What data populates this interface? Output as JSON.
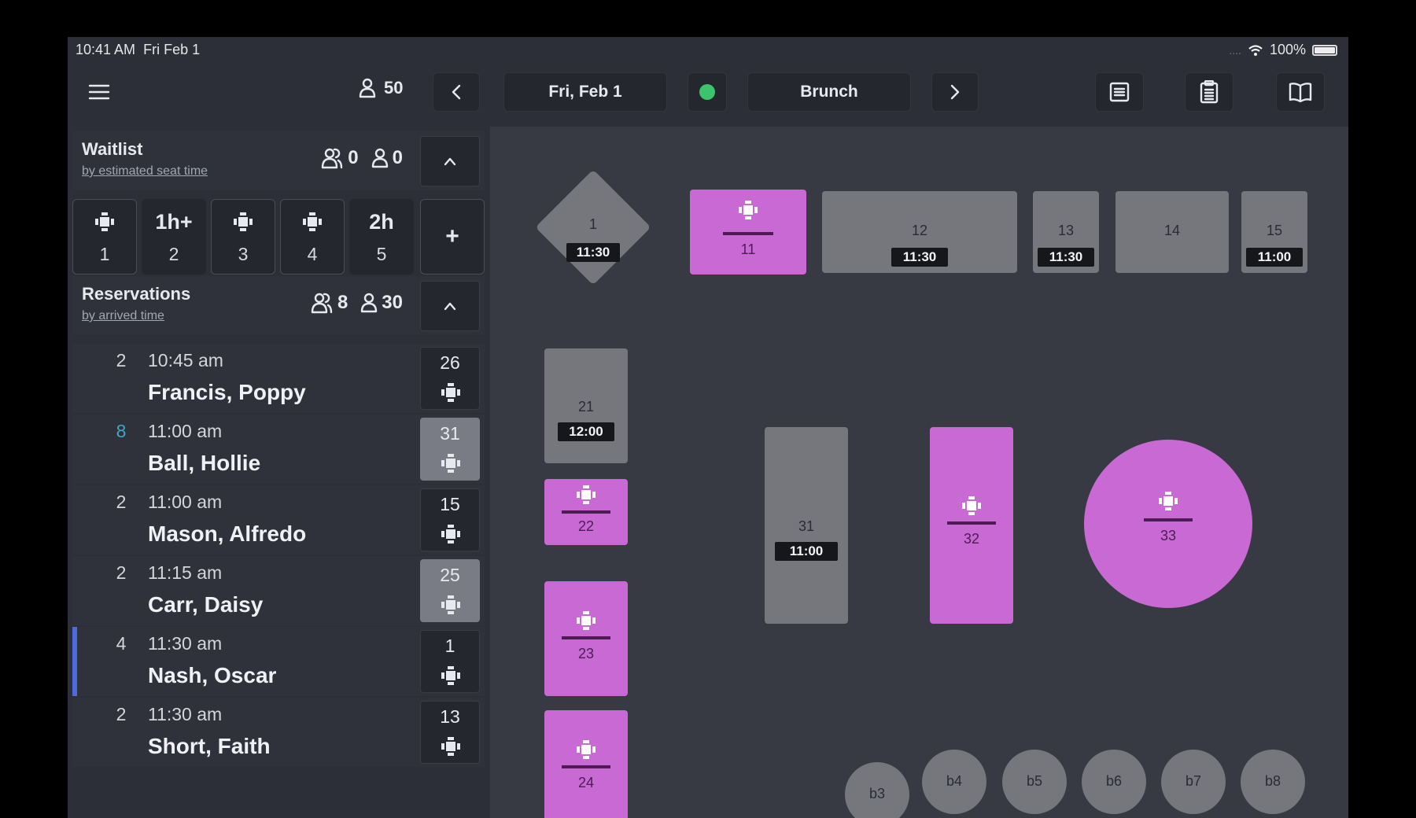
{
  "status_bar": {
    "time": "10:41 AM",
    "date": "Fri Feb 1",
    "battery": "100%",
    "cellular_dots": "...."
  },
  "top_bar": {
    "covers": "50",
    "date": "Fri, Feb 1",
    "shift_status_color": "#3cc46a",
    "shift": "Brunch",
    "icons": [
      "menu-icon",
      "person-icon",
      "chevron-left-icon",
      "chevron-right-icon",
      "list-icon",
      "clipboard-icon",
      "book-icon"
    ]
  },
  "waitlist": {
    "title": "Waitlist",
    "sort": "by estimated seat time",
    "parties": "0",
    "guests": "0",
    "tiles": [
      {
        "top": "",
        "icon": "table-icon",
        "bottom": "1"
      },
      {
        "top": "1h+",
        "icon": "",
        "bottom": "2"
      },
      {
        "top": "",
        "icon": "table-icon",
        "bottom": "3"
      },
      {
        "top": "",
        "icon": "table-icon",
        "bottom": "4"
      },
      {
        "top": "2h",
        "icon": "",
        "bottom": "5"
      }
    ],
    "add_label": "+"
  },
  "reservations": {
    "title": "Reservations",
    "sort": "by arrived time",
    "parties": "8",
    "guests": "30",
    "rows": [
      {
        "party": "2",
        "time": "10:45 am",
        "name": "Francis, Poppy",
        "table": "26"
      },
      {
        "party": "8",
        "time": "11:00 am",
        "name": "Ball, Hollie",
        "table": "31"
      },
      {
        "party": "2",
        "time": "11:00 am",
        "name": "Mason, Alfredo",
        "table": "15"
      },
      {
        "party": "2",
        "time": "11:15 am",
        "name": "Carr, Daisy",
        "table": "25"
      },
      {
        "party": "4",
        "time": "11:30 am",
        "name": "Nash, Oscar",
        "table": "1"
      },
      {
        "party": "2",
        "time": "11:30 am",
        "name": "Short, Faith",
        "table": "13"
      }
    ]
  },
  "floor": {
    "colors": {
      "available": "#75777d",
      "seated": "#c969d3",
      "badge": "#15171b"
    },
    "tables": {
      "t1": {
        "num": "1",
        "time": "11:30"
      },
      "t11": {
        "num": "11"
      },
      "t12": {
        "num": "12",
        "time": "11:30"
      },
      "t13": {
        "num": "13",
        "time": "11:30"
      },
      "t14": {
        "num": "14"
      },
      "t15": {
        "num": "15",
        "time": "11:00"
      },
      "t21": {
        "num": "21",
        "time": "12:00"
      },
      "t22": {
        "num": "22"
      },
      "t23": {
        "num": "23"
      },
      "t24": {
        "num": "24"
      },
      "t31": {
        "num": "31",
        "time": "11:00"
      },
      "t32": {
        "num": "32"
      },
      "t33": {
        "num": "33"
      }
    },
    "bar_seats": [
      "b3",
      "b4",
      "b5",
      "b6",
      "b7",
      "b8"
    ]
  }
}
